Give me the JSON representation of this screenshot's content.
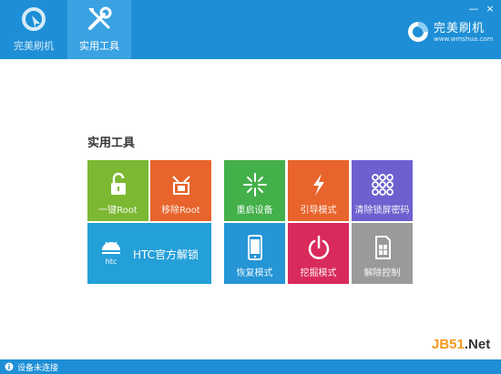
{
  "window": {
    "minimize_glyph": "—",
    "close_glyph": "×"
  },
  "nav": {
    "tabs": [
      {
        "label": "完美刷机",
        "icon": "refresh-arrow-icon",
        "active": false
      },
      {
        "label": "实用工具",
        "icon": "tools-icon",
        "active": true
      }
    ]
  },
  "brand": {
    "name": "完美刷机",
    "url": "www.wmshua.com"
  },
  "main": {
    "section_title": "实用工具",
    "tiles": [
      {
        "label": "一键Root",
        "icon": "unlock-icon",
        "color": "#7cb832"
      },
      {
        "label": "移除Root",
        "icon": "remove-root-icon",
        "color": "#e8642c"
      },
      {
        "label": "HTC官方解锁",
        "icon": "htc-android-icon",
        "color": "#24a0d8"
      },
      {
        "label": "重启设备",
        "icon": "spark-icon",
        "color": "#44b04a"
      },
      {
        "label": "引导模式",
        "icon": "lightning-icon",
        "color": "#e8642c"
      },
      {
        "label": "清除锁屏密码",
        "icon": "pattern-grid-icon",
        "color": "#6e61cf"
      },
      {
        "label": "恢复模式",
        "icon": "phone-icon",
        "color": "#2595d6"
      },
      {
        "label": "挖掘模式",
        "icon": "power-icon",
        "color": "#d92a5c"
      },
      {
        "label": "解除控制",
        "icon": "sim-card-icon",
        "color": "#9a9a9a"
      }
    ]
  },
  "status": {
    "text": "设备未连接",
    "icon": "info-icon"
  },
  "watermark": {
    "part1": "JB51",
    "part2": ".Net"
  }
}
